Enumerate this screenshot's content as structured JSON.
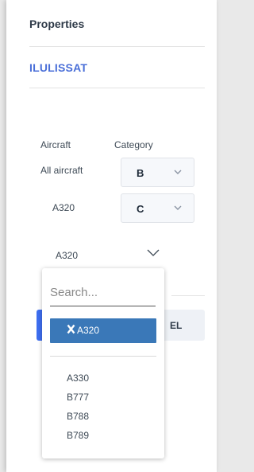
{
  "panel": {
    "title": "Properties",
    "airport": "ILULISSAT"
  },
  "table": {
    "headers": {
      "aircraft": "Aircraft",
      "category": "Category"
    },
    "rows": [
      {
        "aircraft": "All aircraft",
        "category": "B"
      },
      {
        "aircraft": "A320",
        "category": "C"
      }
    ]
  },
  "aircraft_select": {
    "value": "A320"
  },
  "dropdown": {
    "search_placeholder": "Search...",
    "selected": "A320",
    "options": [
      "A330",
      "B777",
      "B788",
      "B789"
    ]
  },
  "buttons": {
    "cancel_label": "EL"
  },
  "colors": {
    "accent": "#4a6fd8",
    "primary_button": "#3d6ef0",
    "selected_chip": "#3a78b8"
  },
  "icons": {
    "select_chevron": "chevron-down-icon",
    "remove": "close-icon"
  }
}
